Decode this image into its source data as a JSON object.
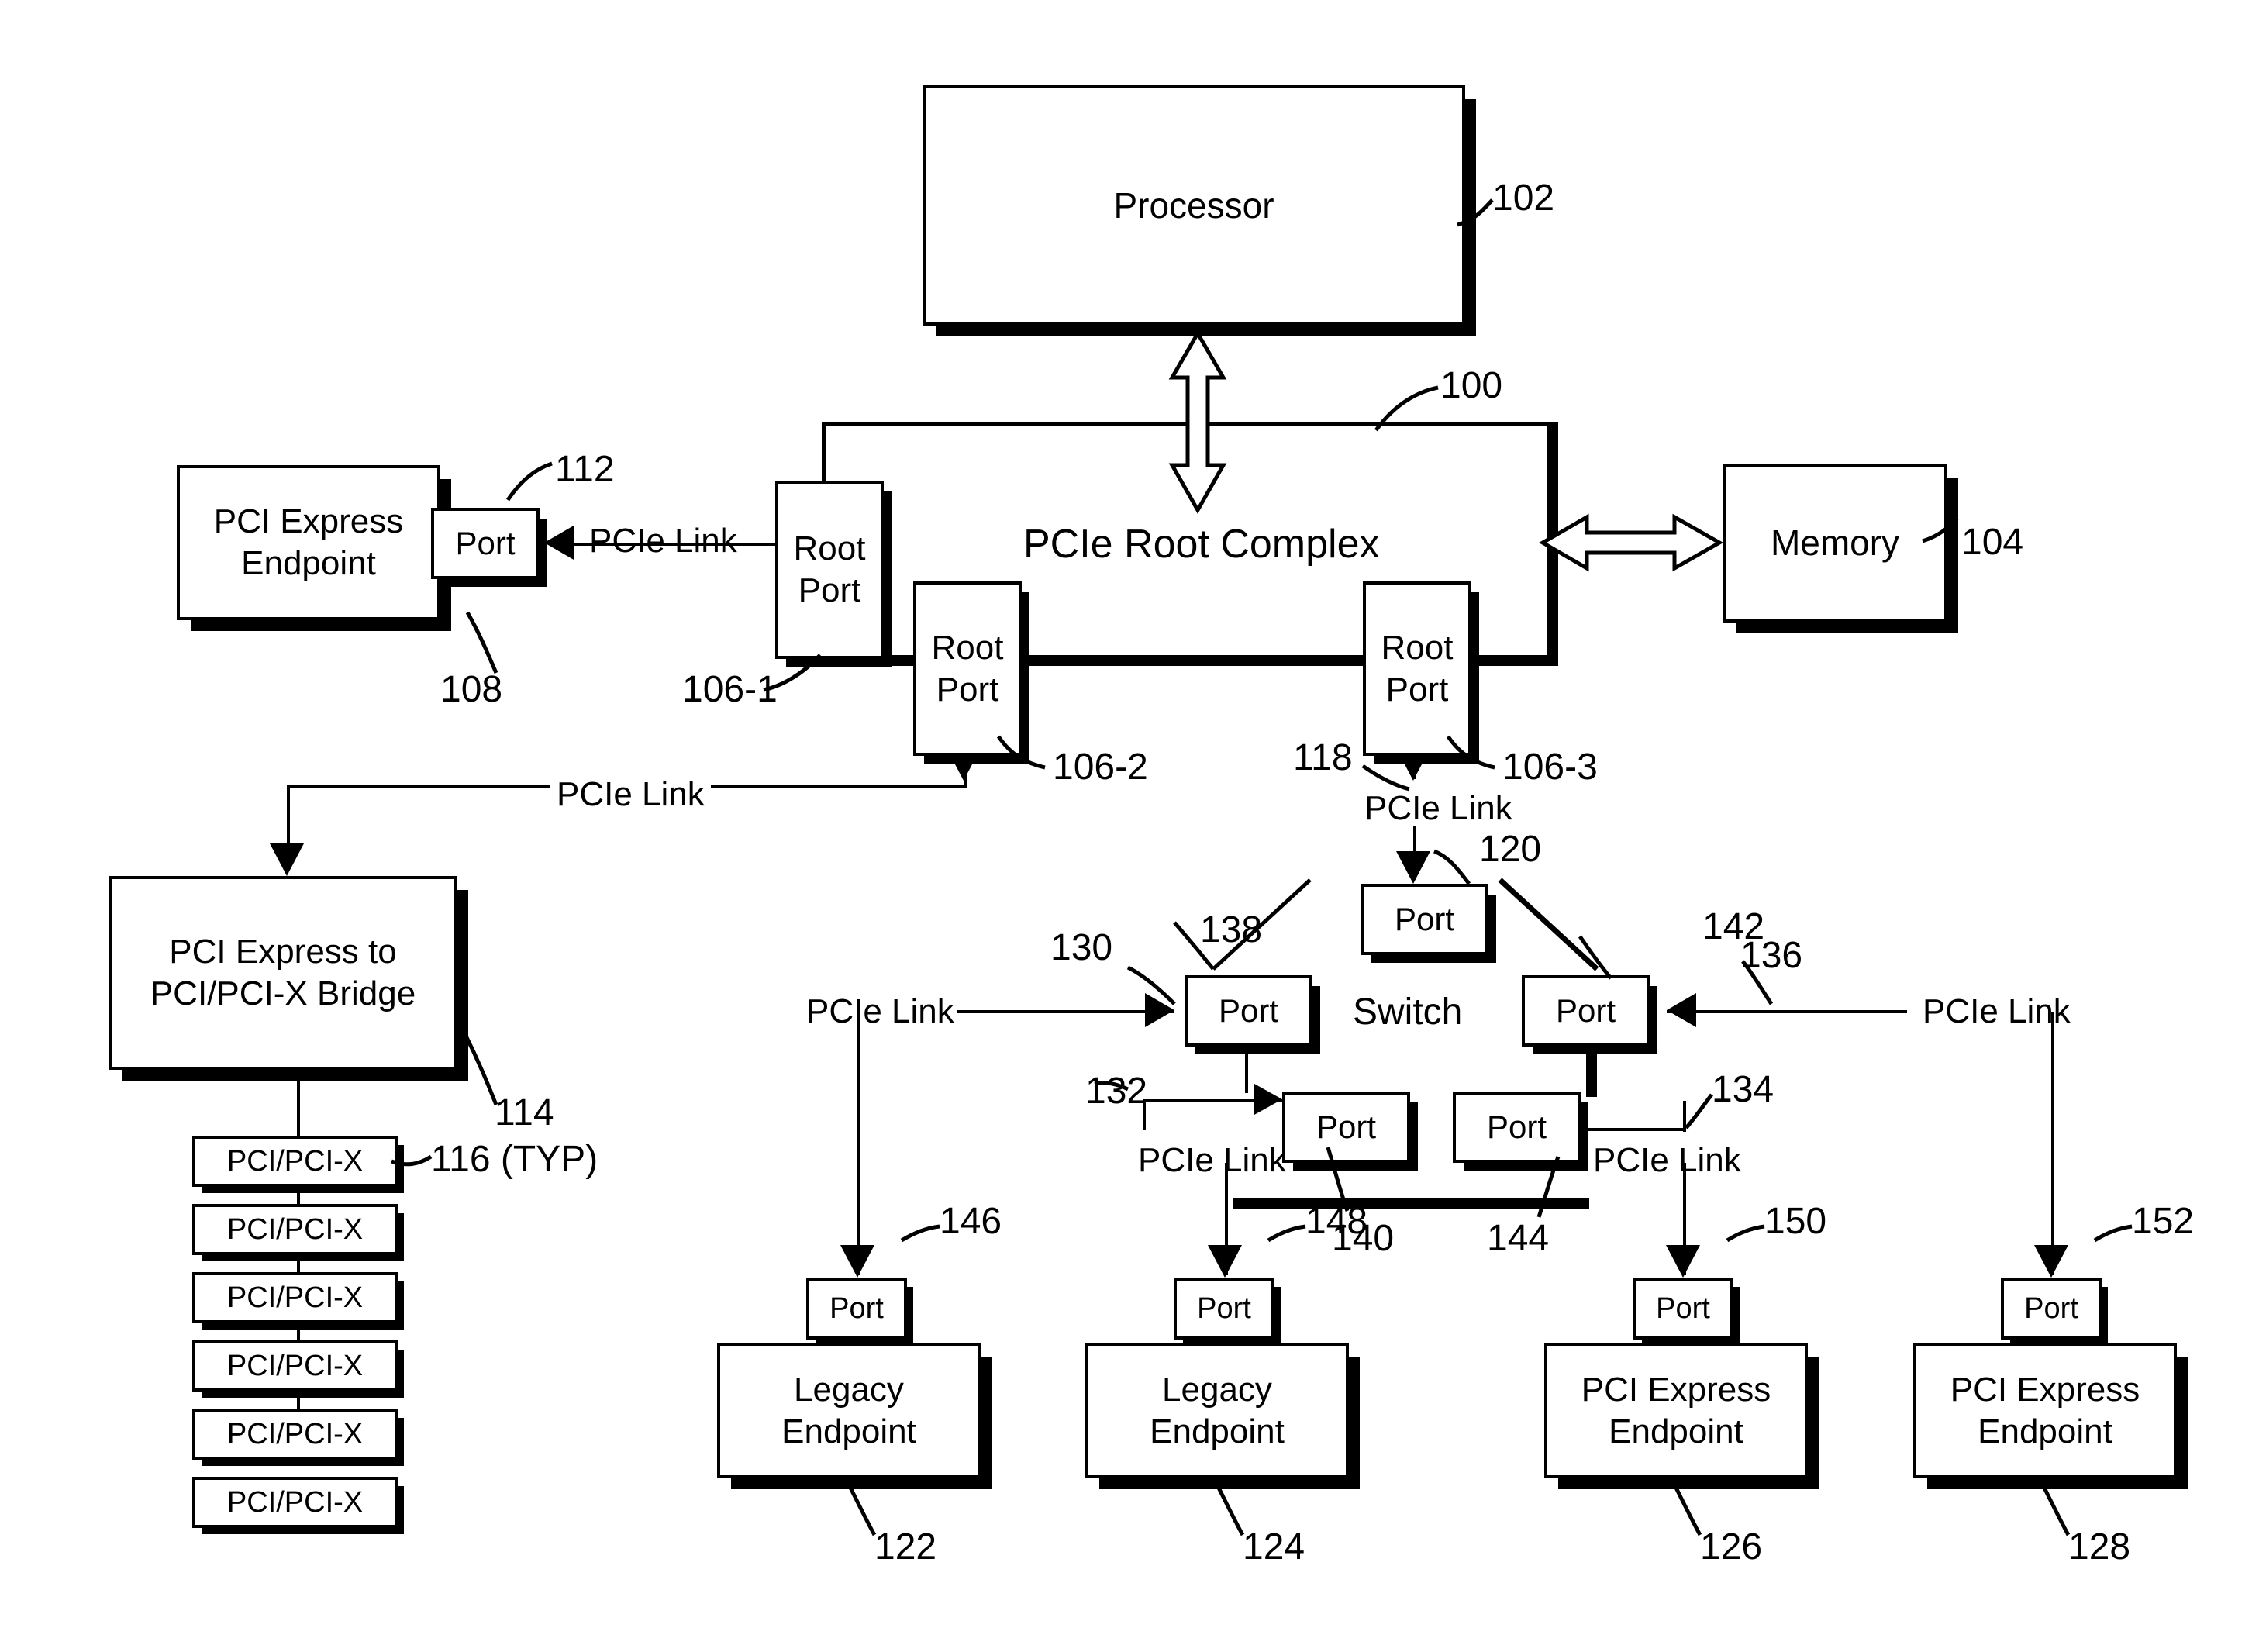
{
  "diagram": {
    "title_blocks": {
      "processor": "Processor",
      "root_complex": "PCIe Root Complex",
      "memory": "Memory",
      "pcie_endpoint_left": "PCI Express\nEndpoint",
      "bridge": "PCI Express to\nPCI/PCI-X Bridge",
      "switch": "Switch"
    },
    "blocks": [
      {
        "id": "processor",
        "label": "Processor",
        "ref": "102"
      },
      {
        "id": "root-complex",
        "label": "PCIe Root Complex",
        "ref": "100"
      },
      {
        "id": "memory",
        "label": "Memory",
        "ref": "104"
      },
      {
        "id": "pcie-endpoint-left",
        "line1": "PCI Express",
        "line2": "Endpoint",
        "ref": "108"
      },
      {
        "id": "bridge",
        "line1": "PCI Express to",
        "line2": "PCI/PCI-X Bridge",
        "ref": "114"
      },
      {
        "id": "legacy-endpoint-1",
        "line1": "Legacy",
        "line2": "Endpoint",
        "ref": "122"
      },
      {
        "id": "legacy-endpoint-2",
        "line1": "Legacy",
        "line2": "Endpoint",
        "ref": "124"
      },
      {
        "id": "pcie-endpoint-1",
        "line1": "PCI Express",
        "line2": "Endpoint",
        "ref": "126"
      },
      {
        "id": "pcie-endpoint-2",
        "line1": "PCI Express",
        "line2": "Endpoint",
        "ref": "128"
      }
    ],
    "root_ports": [
      {
        "id": "root-port-1",
        "line1": "Root",
        "line2": "Port",
        "ref": "106-1"
      },
      {
        "id": "root-port-2",
        "line1": "Root",
        "line2": "Port",
        "ref": "106-2"
      },
      {
        "id": "root-port-3",
        "line1": "Root",
        "line2": "Port",
        "ref": "106-3"
      }
    ],
    "ports": [
      {
        "id": "port-112",
        "label": "Port",
        "ref": "112"
      },
      {
        "id": "port-120",
        "label": "Port",
        "ref": "120"
      },
      {
        "id": "port-138",
        "label": "Port",
        "ref": "138"
      },
      {
        "id": "port-142",
        "label": "Port",
        "ref": "142"
      },
      {
        "id": "port-140",
        "label": "Port",
        "ref": "140"
      },
      {
        "id": "port-144",
        "label": "Port",
        "ref": "144"
      },
      {
        "id": "port-146",
        "label": "Port",
        "ref": "146"
      },
      {
        "id": "port-148",
        "label": "Port",
        "ref": "148"
      },
      {
        "id": "port-150",
        "label": "Port",
        "ref": "150"
      },
      {
        "id": "port-152",
        "label": "Port",
        "ref": "152"
      }
    ],
    "pci_x_slots": [
      {
        "label": "PCI/PCI-X"
      },
      {
        "label": "PCI/PCI-X"
      },
      {
        "label": "PCI/PCI-X"
      },
      {
        "label": "PCI/PCI-X"
      },
      {
        "label": "PCI/PCI-X"
      },
      {
        "label": "PCI/PCI-X"
      }
    ],
    "pci_x_ref": "116 (TYP)",
    "link_labels": [
      {
        "id": "link-112-106-1",
        "text": "PCIe Link"
      },
      {
        "id": "link-bridge",
        "text": "PCIe Link"
      },
      {
        "id": "link-118",
        "text": "PCIe Link",
        "ref": "118"
      },
      {
        "id": "link-130",
        "text": "PCIe Link",
        "ref": "130"
      },
      {
        "id": "link-132",
        "text": "PCIe Link",
        "ref": "132"
      },
      {
        "id": "link-134",
        "text": "PCIe Link",
        "ref": "134"
      },
      {
        "id": "link-136",
        "text": "PCIe Link",
        "ref": "136"
      }
    ],
    "refs": {
      "r100": "100",
      "r102": "102",
      "r104": "104",
      "r106_1": "106-1",
      "r106_2": "106-2",
      "r106_3": "106-3",
      "r108": "108",
      "r112": "112",
      "r114": "114",
      "r116": "116 (TYP)",
      "r118": "118",
      "r120": "120",
      "r122": "122",
      "r124": "124",
      "r126": "126",
      "r128": "128",
      "r130": "130",
      "r132": "132",
      "r134": "134",
      "r136": "136",
      "r138": "138",
      "r140": "140",
      "r142": "142",
      "r144": "144",
      "r146": "146",
      "r148": "148",
      "r150": "150",
      "r152": "152"
    },
    "texts": {
      "processor": "Processor",
      "root_complex": "PCIe Root Complex",
      "memory": "Memory",
      "switch": "Switch",
      "port": "Port",
      "root": "Root",
      "port_word": "Port",
      "pcie_link": "PCIe Link",
      "pci_express": "PCI Express",
      "endpoint": "Endpoint",
      "legacy": "Legacy",
      "bridge_l1": "PCI Express to",
      "bridge_l2": "PCI/PCI-X Bridge",
      "pci_pci_x": "PCI/PCI-X"
    },
    "colors": {
      "ink": "#000000",
      "paper": "#ffffff"
    }
  }
}
